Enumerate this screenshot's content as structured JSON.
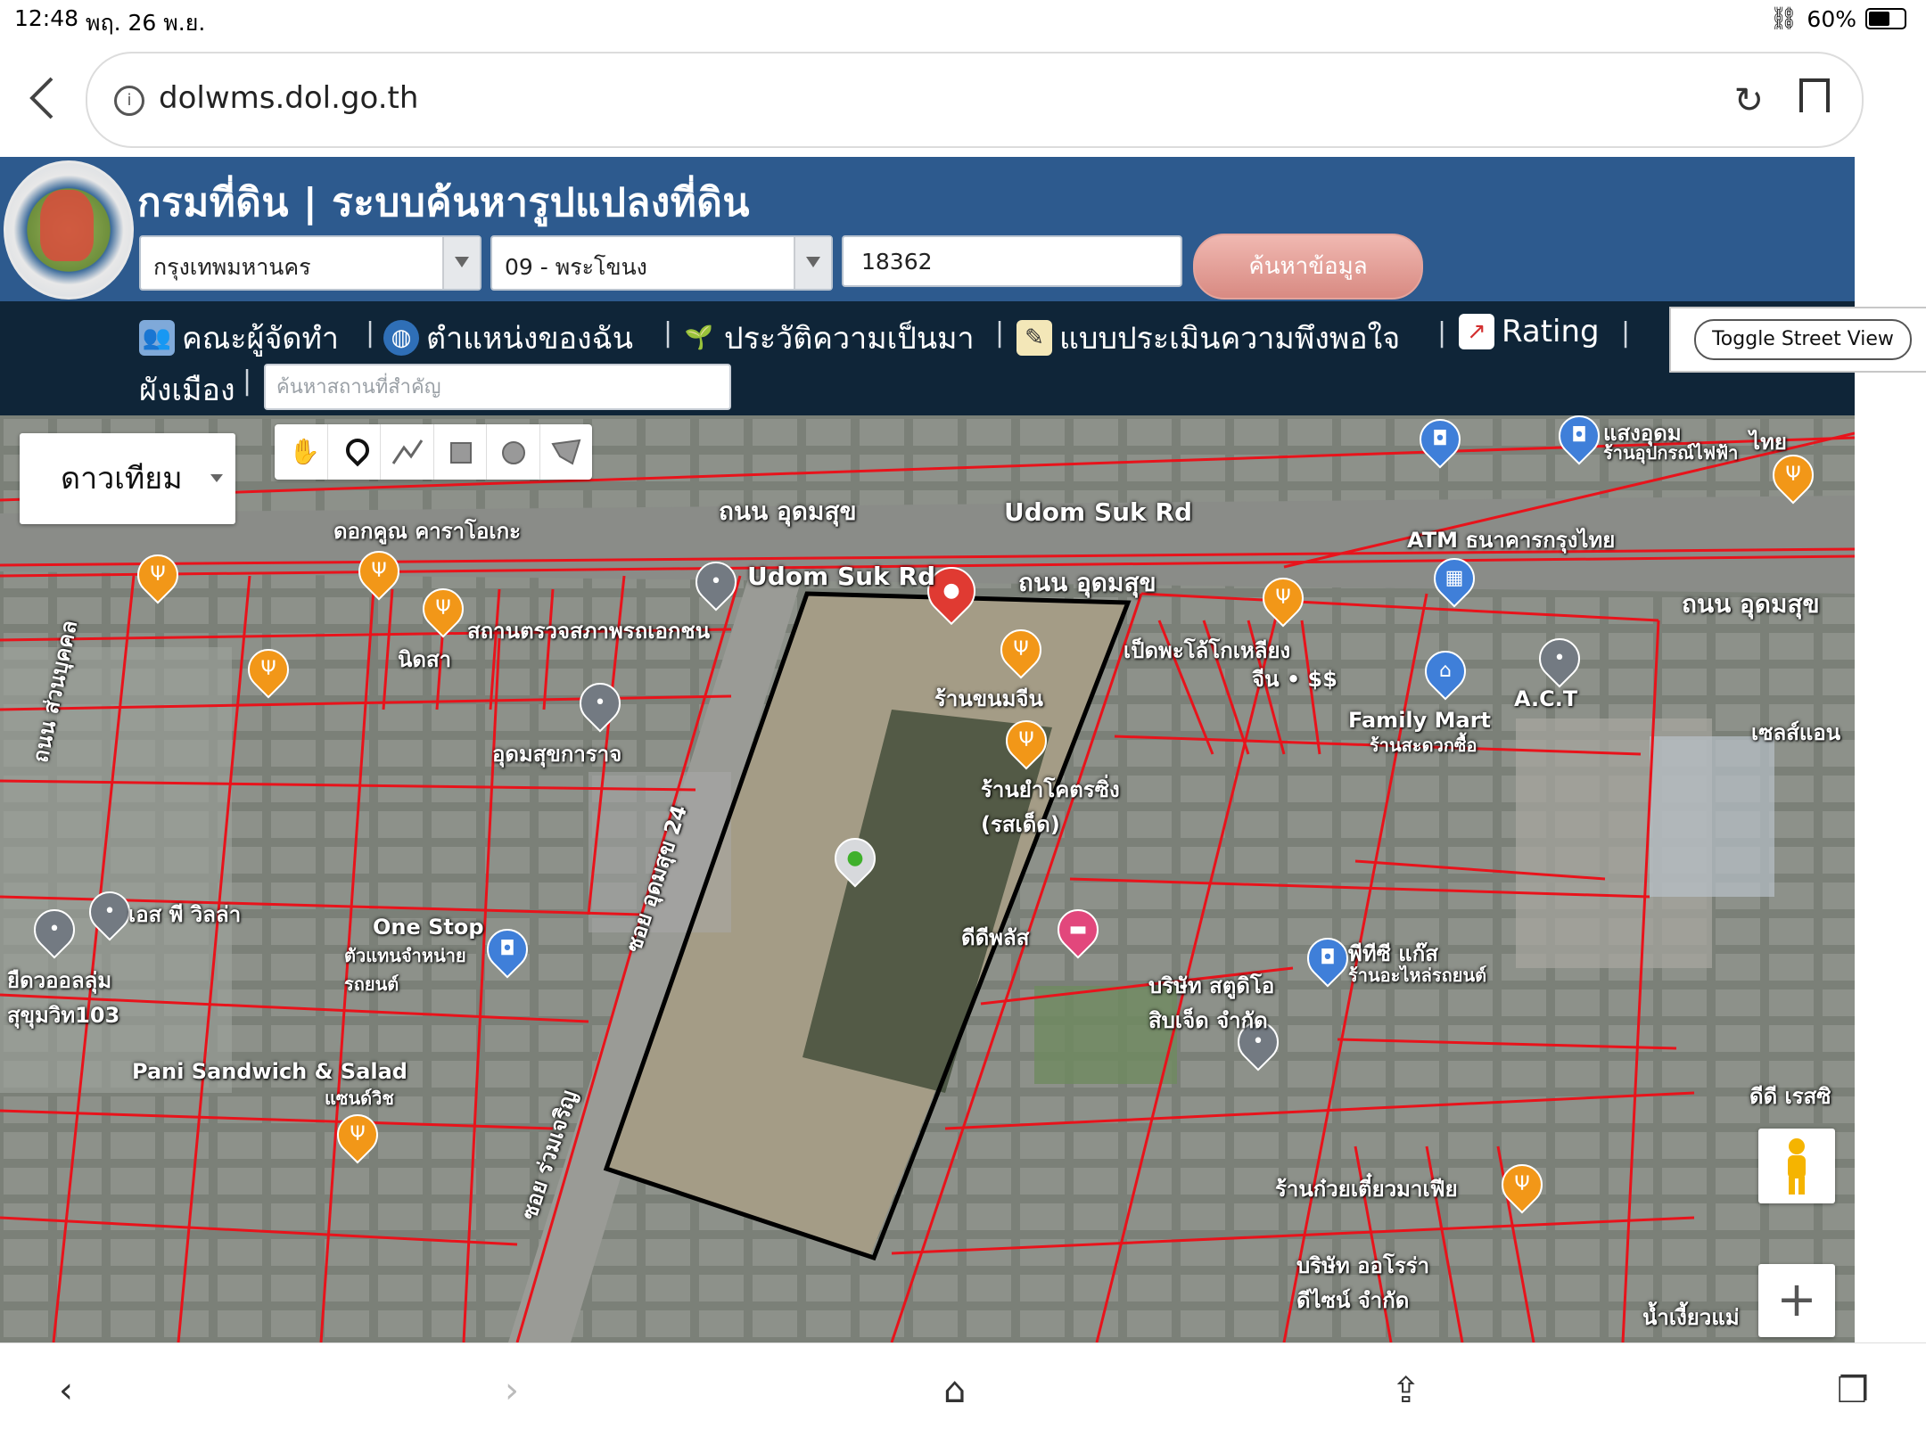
{
  "status_bar": {
    "time": "12:48",
    "date": "พฤ. 26 พ.ย.",
    "battery": "60%",
    "battery_level": 0.6
  },
  "browser": {
    "url": "dolwms.dol.go.th",
    "info_icon": "info-icon",
    "reload_icon": "reload-icon",
    "bookmark_icon": "bookmark-icon"
  },
  "header": {
    "title": "กรมที่ดิน | ระบบค้นหารูปแปลงที่ดิน",
    "province": "กรุงเทพมหานคร",
    "district": "09 - พระโขนง",
    "parcel_number": "18362",
    "search_button": "ค้นหาข้อมูล"
  },
  "nav": {
    "items": [
      {
        "label": "คณะผู้จัดทำ",
        "icon": "team-icon"
      },
      {
        "label": "ตำแหน่งของฉัน",
        "icon": "globe-icon"
      },
      {
        "label": "ประวัติความเป็นมา",
        "icon": "sprout-icon"
      },
      {
        "label": "แบบประเมินความพึงพอใจ",
        "icon": "form-icon"
      },
      {
        "label": "Rating",
        "icon": "chart-icon"
      }
    ],
    "second_row_label": "ผังเมือง",
    "separator": "|",
    "landmark_placeholder": "ค้นหาสถานที่สำคัญ",
    "toggle_street_view": "Toggle Street View"
  },
  "map": {
    "layer_selector": "ดาวเทียม",
    "labels": [
      {
        "text": "ถนน อุดมสุข",
        "id": "road-udomsuk-th-1"
      },
      {
        "text": "Udom Suk Rd",
        "id": "road-udomsuk-en-1"
      },
      {
        "text": "Udom Suk Rd",
        "id": "road-udomsuk-en-2"
      },
      {
        "text": "ถนน อุดมสุข",
        "id": "road-udomsuk-th-2"
      },
      {
        "text": "ถนน อุดมสุข",
        "id": "road-udomsuk-th-3"
      },
      {
        "text": "ดอกคูณ คาราโอเกะ",
        "id": "dokkoon-karaoke"
      },
      {
        "text": "สถานตรวจสภาพรถเอกชน",
        "id": "vehicle-inspection"
      },
      {
        "text": "นิดสา",
        "id": "nidsa"
      },
      {
        "text": "อุดมสุขการาจ",
        "id": "udomsuk-garage"
      },
      {
        "text": "ร้านขนมจีน",
        "id": "khanom-jeen"
      },
      {
        "text": "ร้านยำโคตรซิ่ง (รสเด็ด)",
        "id": "yum-shop"
      },
      {
        "text": "เป็ดพะโล้โกเหลียง",
        "id": "duck-shop"
      },
      {
        "text": "จีน • $$",
        "id": "duck-shop-sub"
      },
      {
        "text": "ATM ธนาคารกรุงไทย",
        "id": "atm-ktb"
      },
      {
        "text": "A.C.T",
        "id": "act"
      },
      {
        "text": "Family Mart",
        "id": "family-mart"
      },
      {
        "text": "ร้านสะดวกซื้อ",
        "id": "family-mart-sub"
      },
      {
        "text": "เซลส์แอน",
        "id": "sales-an"
      },
      {
        "text": "แสงอุดม",
        "id": "saeng-udom"
      },
      {
        "text": "ร้านอุปกรณ์ไฟฟ้า",
        "id": "saeng-udom-sub"
      },
      {
        "text": "ไทย",
        "id": "thai-label"
      },
      {
        "text": "ถนน ส่วนบุคคล",
        "id": "private-road"
      },
      {
        "text": "ซอย อุดมสุข 24",
        "id": "soi-udomsuk-24"
      },
      {
        "text": "ซอย ร่วมเจริญ",
        "id": "soi-ruamcharoen"
      },
      {
        "text": "เอส พี วิลล่า",
        "id": "sp-villa"
      },
      {
        "text": "ยืดวออลลุ่ม สุขุมวิท103",
        "id": "sukhumvit-103"
      },
      {
        "text": "One Stop",
        "id": "one-stop"
      },
      {
        "text": "ตัวแทนจำหน่ายรถยนต์",
        "id": "one-stop-sub"
      },
      {
        "text": "ดีดีพลัส",
        "id": "dd-plus"
      },
      {
        "text": "บริษัท สตูดิโอ สิบเจ็ด จำกัด",
        "id": "studio-17"
      },
      {
        "text": "พีทีซี แก๊ส",
        "id": "ptc-gas"
      },
      {
        "text": "ร้านอะไหล่รถยนต์",
        "id": "ptc-gas-sub"
      },
      {
        "text": "Pani Sandwich & Salad",
        "id": "pani-sandwich"
      },
      {
        "text": "แซนด์วิช",
        "id": "pani-sandwich-sub"
      },
      {
        "text": "ร้านก๋วยเตี๋ยวมาเฟีย",
        "id": "noodle-mafia"
      },
      {
        "text": "บริษัท ออโรร่า ดีไซน์ จำกัด",
        "id": "aurora-design"
      },
      {
        "text": "ดีดี เรสซิ",
        "id": "dd-res"
      },
      {
        "text": "น้ำเงี้ยวแม่",
        "id": "nam-ngiao"
      }
    ],
    "zoom_in": "+",
    "pegman_icon": "pegman-icon"
  },
  "colors": {
    "header_bg": "#2d5a8e",
    "nav_bg": "#0f2538",
    "parcel_lines": "#e8131b",
    "selected_parcel": "#000000",
    "search_button": "#d88a82"
  },
  "bottom_bar": {
    "icons": [
      "back-icon",
      "forward-icon",
      "home-icon",
      "share-icon",
      "tabs-icon"
    ]
  }
}
